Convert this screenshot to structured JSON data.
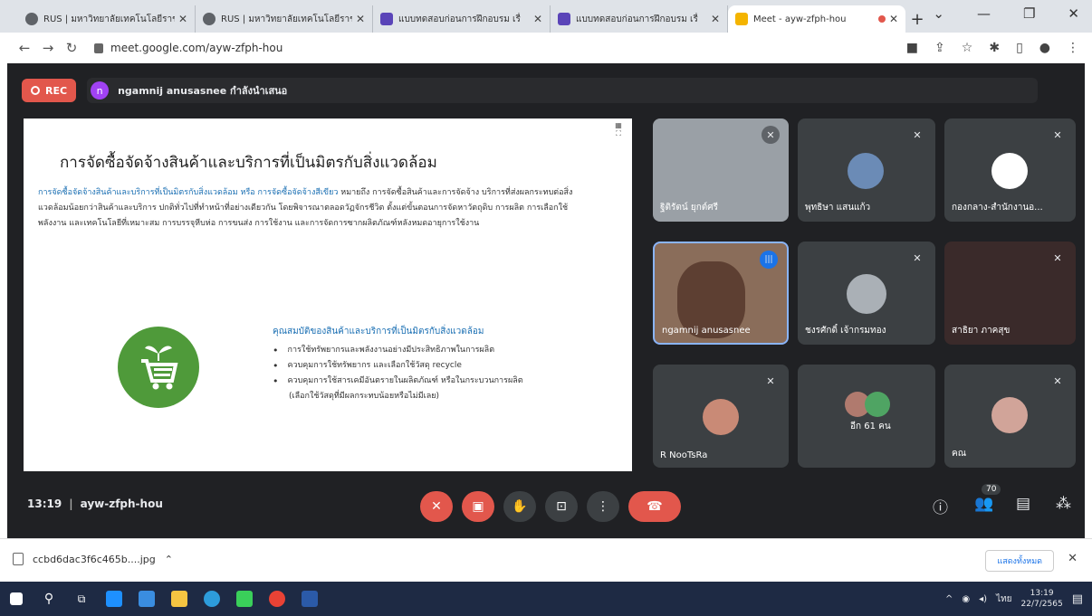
{
  "browser": {
    "tabs": [
      {
        "title": "RUS | มหาวิทยาลัยเทคโนโลยีราช",
        "color": "#5f6368",
        "active": false
      },
      {
        "title": "RUS | มหาวิทยาลัยเทคโนโลยีราช",
        "color": "#5f6368",
        "active": false
      },
      {
        "title": "แบบทดสอบก่อนการฝึกอบรม เรื่",
        "color": "#5a44b8",
        "active": false
      },
      {
        "title": "แบบทดสอบก่อนการฝึกอบรม เรื่",
        "color": "#5a44b8",
        "active": false
      },
      {
        "title": "Meet - ayw-zfph-hou",
        "color": "#f4b400",
        "active": true
      }
    ],
    "new_tab": "+",
    "url": "meet.google.com/ayw-zfph-hou"
  },
  "meet": {
    "rec_label": "REC",
    "presenter_initial": "n",
    "presenter_label": "ngamnij anusasnee กำลังนำเสนอ",
    "slide": {
      "title": "การจัดซื้อจัดจ้างสินค้าและบริการที่เป็นมิตรกับสิ่งแวดล้อม",
      "para_highlight": "การจัดซื้อจัดจ้างสินค้าและบริการที่เป็นมิตรกับสิ่งแวดล้อม หรือ การจัดซื้อจัดจ้างสีเขียว",
      "para_text": " หมายถึง การจัดซื้อสินค้าและการจัดจ้าง บริการที่ส่งผลกระทบต่อสิ่งแวดล้อมน้อยกว่าสินค้าและบริการ ปกติทั่วไปที่ทำหน้าที่อย่างเดียวกัน โดยพิจารณาตลอดวัฏจักรชีวิต ตั้งแต่ขั้นตอนการจัดหาวัตถุดิบ การผลิต การเลือกใช้พลังงาน และเทคโนโลยีที่เหมาะสม การบรรจุหีบห่อ การขนส่ง การใช้งาน และการจัดการซากผลิตภัณฑ์หลังหมดอายุการใช้งาน",
      "sub_title": "คุณสมบัติของสินค้าและบริการที่เป็นมิตรกับสิ่งแวดล้อม",
      "bullets": [
        "การใช้ทรัพยากรและพลังงานอย่างมีประสิทธิภาพในการผลิต",
        "ควบคุมการใช้ทรัพยากร และเลือกใช้วัสดุ recycle",
        "ควบคุมการใช้สารเคมีอันตรายในผลิตภัณฑ์ หรือในกระบวนการผลิต"
      ],
      "bullet_cont": "(เลือกใช้วัสดุที่มีผลกระทบน้อยหรือไม่มีเลย)"
    },
    "participants": [
      {
        "name": "ฐิติรัตน์ ยุกต์ศรี",
        "bg": "#9aa0a6"
      },
      {
        "name": "พุทธิษา แสนแก้ว",
        "bg": "#3c4043"
      },
      {
        "name": "กองกลาง-สำนักงานอ...",
        "bg": "#3c4043"
      },
      {
        "name": "ngamnij anusasnee",
        "bg": "#8a6d5a"
      },
      {
        "name": "ชงรศักดิ์ เจ้ากรมทอง",
        "bg": "#3c4043"
      },
      {
        "name": "สาธิยา ภาคสุข",
        "bg": "#3a2a2a"
      },
      {
        "name": "R NooTsRa",
        "bg": "#3c4043"
      },
      {
        "name": "อีก 61 คน",
        "bg": "#3c4043"
      },
      {
        "name": "คณ",
        "bg": "#3c4043"
      }
    ],
    "time": "13:19",
    "meeting_code": "ayw-zfph-hou",
    "people_count": "70"
  },
  "downloads": {
    "file": "ccbd6dac3f6c465b....jpg",
    "show_all": "แสดงทั้งหมด"
  },
  "taskbar": {
    "time": "13:19",
    "date": "22/7/2565",
    "lang": "ไทย"
  }
}
